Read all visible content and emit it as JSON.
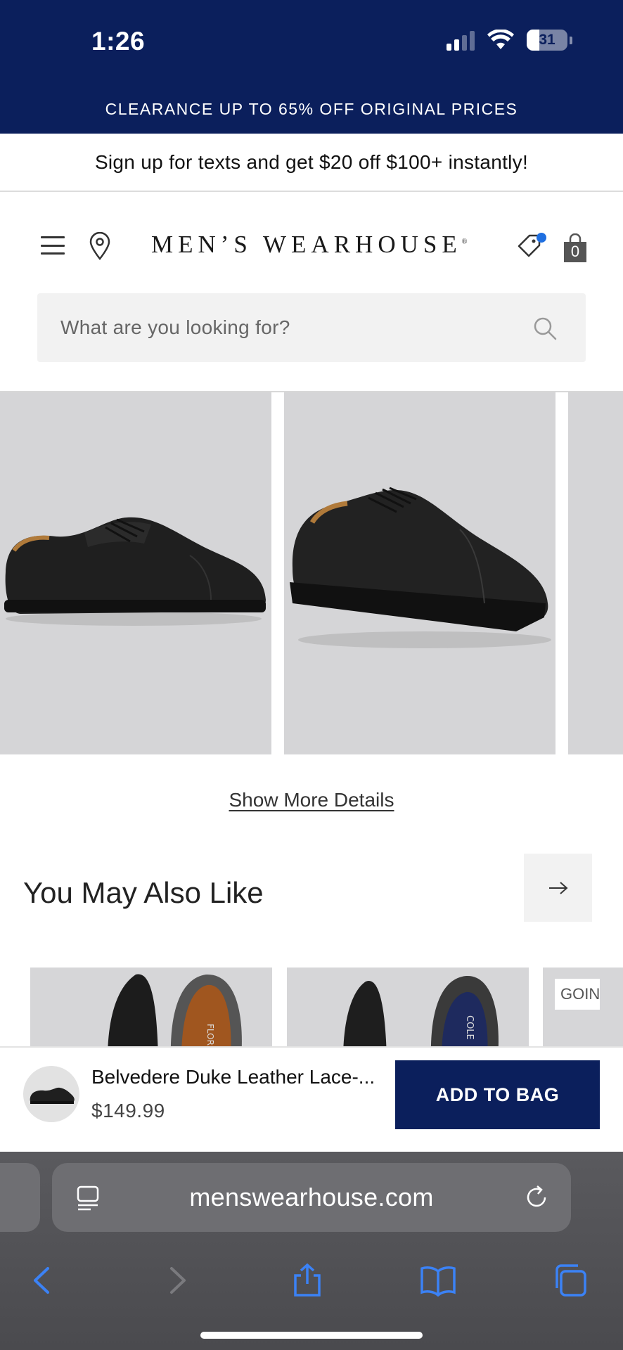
{
  "status_bar": {
    "time": "1:26",
    "battery": "31",
    "battery_level": 0.31
  },
  "promo": {
    "text": "CLEARANCE UP TO 65% OFF ORIGINAL PRICES"
  },
  "signup": {
    "text": "Sign up for texts and get $20 off $100+ instantly!"
  },
  "header": {
    "logo": "MEN’S WEARHOUSE",
    "bag_count": "0"
  },
  "search": {
    "placeholder": "What are you looking for?"
  },
  "gallery": {
    "link": "Show More Details"
  },
  "ymal": {
    "title": "You May Also Like",
    "badge": "GOIN"
  },
  "sticky_bar": {
    "product_name": "Belvedere Duke Leather Lace-...",
    "price": "$149.99",
    "button": "ADD TO BAG"
  },
  "browser": {
    "url": "menswearhouse.com"
  },
  "colors": {
    "navy": "#0b1f5c",
    "accent_blue": "#1f6fe0",
    "ios_blue": "#3b82f6"
  }
}
